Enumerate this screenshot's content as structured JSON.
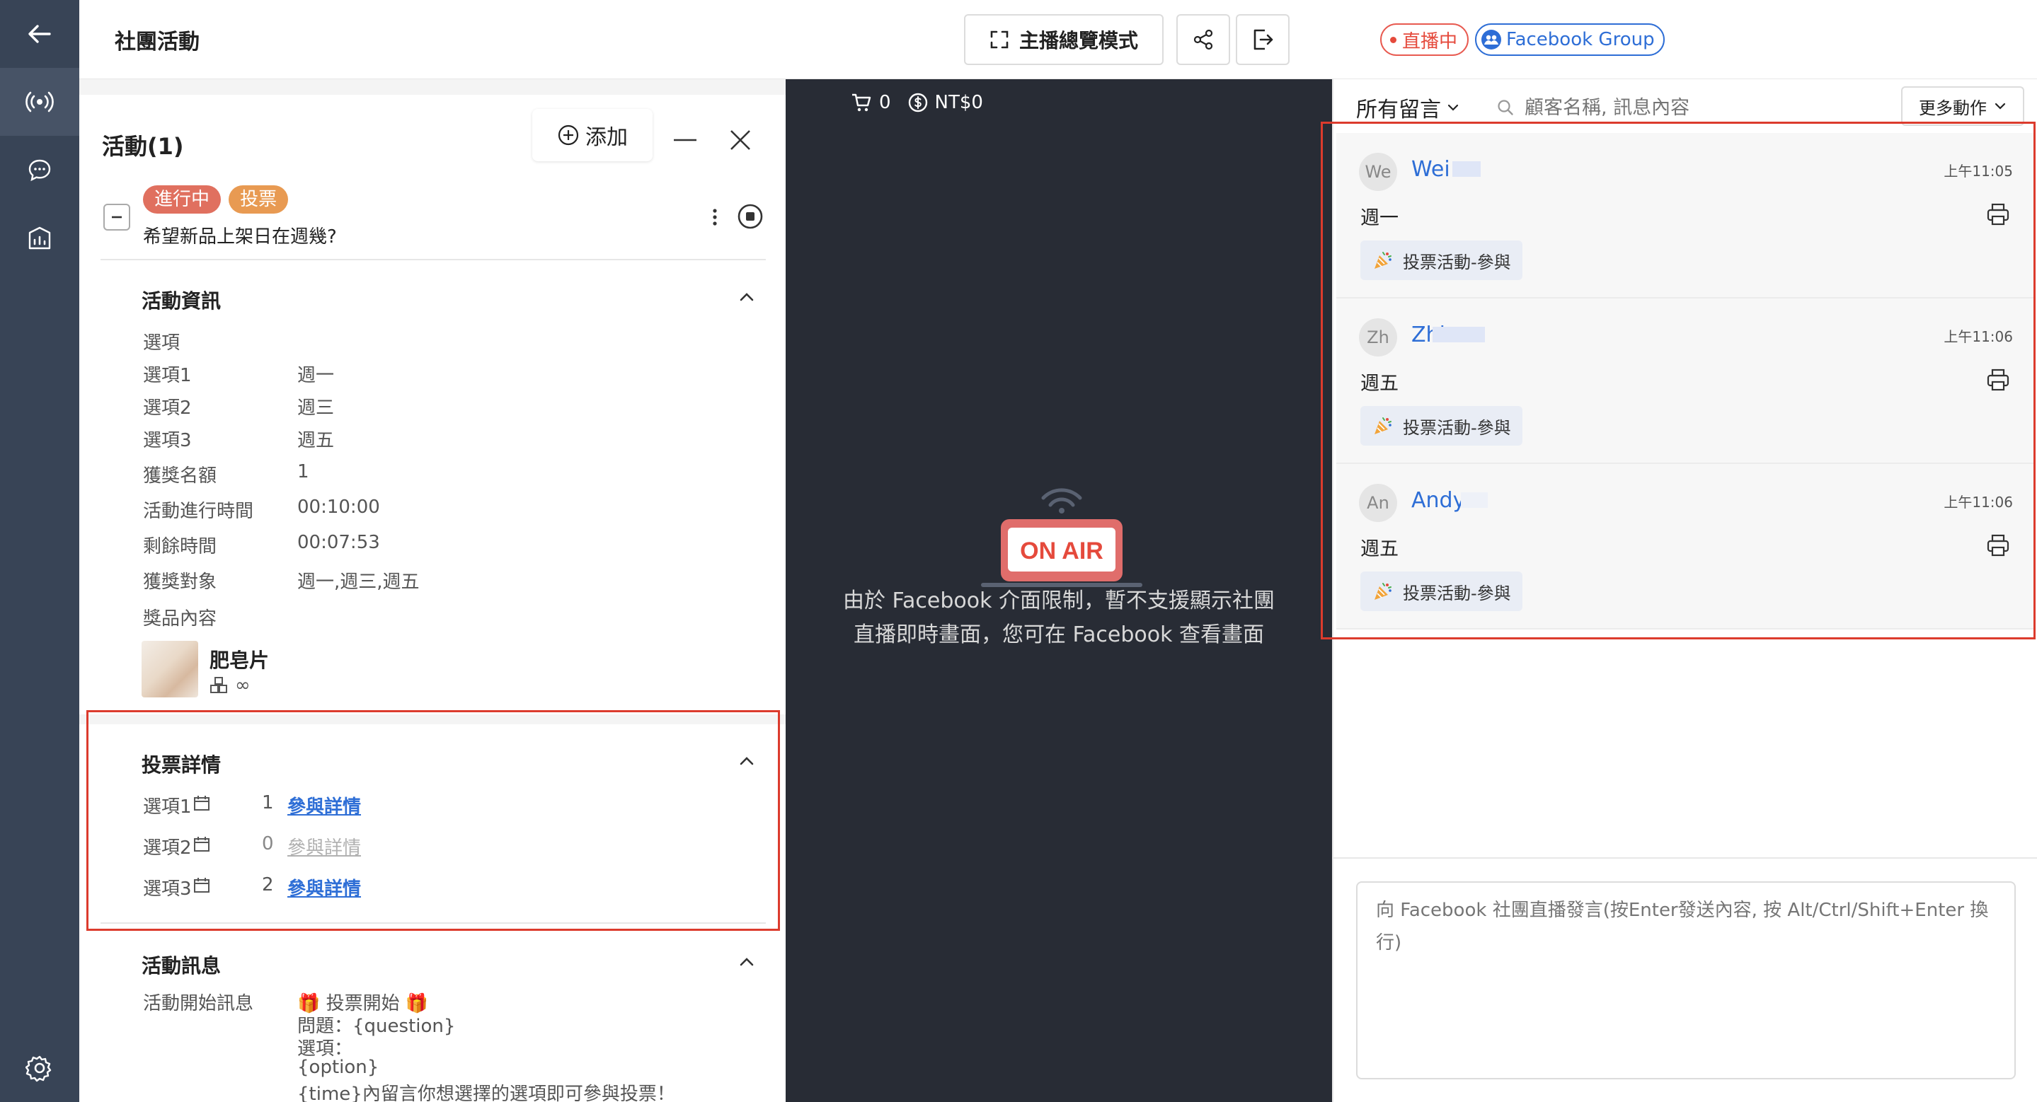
{
  "header": {
    "title": "社團活動",
    "live_badge": "直播中",
    "fb_badge": "Facebook Group",
    "overview_label": "主播總覽模式"
  },
  "activity": {
    "title": "活動(1)",
    "add_label": "添加",
    "tag_status": "進行中",
    "tag_type": "投票",
    "question": "希望新品上架日在週幾?",
    "info_title": "活動資訊",
    "options_label": "選項",
    "rows": [
      {
        "label": "選項1",
        "value": "週一"
      },
      {
        "label": "選項2",
        "value": "週三"
      },
      {
        "label": "選項3",
        "value": "週五"
      },
      {
        "label": "獲獎名額",
        "value": "1"
      },
      {
        "label": "活動進行時間",
        "value": "00:10:00"
      },
      {
        "label": "剩餘時間",
        "value": "00:07:53"
      },
      {
        "label": "獲獎對象",
        "value": "週一,週三,週五"
      }
    ],
    "prize_label": "獎品內容",
    "prize_name": "肥皂片",
    "prize_qty": "∞",
    "vote_title": "投票詳情",
    "votes": [
      {
        "label": "選項1",
        "count": "1",
        "link": "參與詳情",
        "enabled": true
      },
      {
        "label": "選項2",
        "count": "0",
        "link": "參與詳情",
        "enabled": false
      },
      {
        "label": "選項3",
        "count": "2",
        "link": "參與詳情",
        "enabled": true
      }
    ],
    "msg_title": "活動訊息",
    "msg_label": "活動開始訊息",
    "msg_lines": [
      "🎁 投票開始 🎁",
      "問題：{question}",
      "選項：",
      "{option}",
      "{time}內留言你想選擇的選項即可參與投票！"
    ]
  },
  "stream": {
    "cart_count": "0",
    "amount": "NT$0",
    "on_air": "ON AIR",
    "notice": "由於 Facebook 介面限制，暫不支援顯示社團直播即時畫面，您可在 Facebook 查看畫面"
  },
  "comments": {
    "filter_label": "所有留言",
    "search_placeholder": "顧客名稱, 訊息內容",
    "more_label": "更多動作",
    "items": [
      {
        "initials": "We",
        "name": "Wei",
        "time": "上午11:05",
        "text": "週一",
        "tag": "投票活動-參與"
      },
      {
        "initials": "Zh",
        "name": "Zhi",
        "time": "上午11:06",
        "text": "週五",
        "tag": "投票活動-參與"
      },
      {
        "initials": "An",
        "name": "Andy",
        "time": "上午11:06",
        "text": "週五",
        "tag": "投票活動-參與"
      }
    ],
    "input_placeholder": "向 Facebook 社團直播發言(按Enter發送內容, 按 Alt/Ctrl/Shift+Enter 換行)"
  },
  "colors": {
    "sidebar": "#384456",
    "accent_blue": "#2e6ed6",
    "live_red": "#e54a3c",
    "tag_status": "#e0705f",
    "tag_type": "#e89a52",
    "highlight_box": "#dc3b2d"
  }
}
